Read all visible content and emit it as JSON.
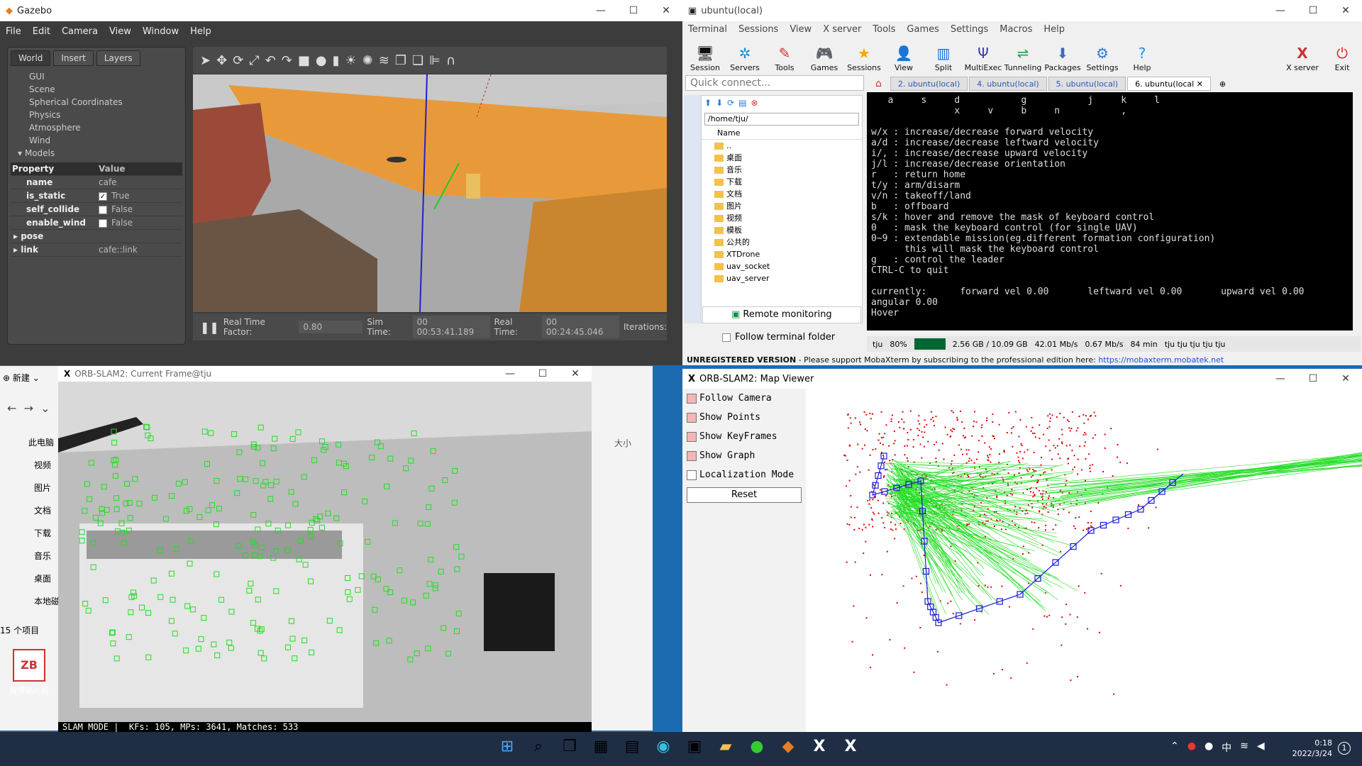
{
  "gazebo": {
    "title": "Gazebo",
    "menu": [
      "File",
      "Edit",
      "Camera",
      "View",
      "Window",
      "Help"
    ],
    "tabs": [
      "World",
      "Insert",
      "Layers"
    ],
    "tree": [
      "GUI",
      "Scene",
      "Spherical Coordinates",
      "Physics",
      "Atmosphere",
      "Wind",
      "Models"
    ],
    "prop_header": [
      "Property",
      "Value"
    ],
    "props": [
      {
        "k": "name",
        "v": "cafe"
      },
      {
        "k": "is_static",
        "v": "True"
      },
      {
        "k": "self_collide",
        "v": "False"
      },
      {
        "k": "enable_wind",
        "v": "False"
      },
      {
        "k": "pose",
        "v": ""
      },
      {
        "k": "link",
        "v": "cafe::link"
      }
    ],
    "status": {
      "rtf_label": "Real Time Factor:",
      "rtf": "0.80",
      "sim_label": "Sim Time:",
      "sim": "00 00:53:41.189",
      "real_label": "Real Time:",
      "real": "00 00:24:45.046",
      "iter_label": "Iterations:"
    }
  },
  "moba": {
    "title": "ubuntu(local)",
    "menu": [
      "Terminal",
      "Sessions",
      "View",
      "X server",
      "Tools",
      "Games",
      "Settings",
      "Macros",
      "Help"
    ],
    "tools": [
      "Session",
      "Servers",
      "Tools",
      "Games",
      "Sessions",
      "View",
      "Split",
      "MultiExec",
      "Tunneling",
      "Packages",
      "Settings",
      "Help",
      "X server",
      "Exit"
    ],
    "quick": "Quick connect...",
    "tabs": [
      "2. ubuntu(local)",
      "4. ubuntu(local)",
      "5. ubuntu(local)",
      "6. ubuntu(local"
    ],
    "path": "/home/tju/",
    "list_header": "Name",
    "files": [
      "..",
      "桌面",
      "音乐",
      "下载",
      "文档",
      "图片",
      "视频",
      "模板",
      "公共的",
      "XTDrone",
      "uav_socket",
      "uav_server"
    ],
    "remote": "Remote monitoring",
    "follow": "Follow terminal folder",
    "term_lines": [
      "   a     s     d           g           j     k     l",
      "               x     v     b     n           ,",
      "",
      "w/x : increase/decrease forward velocity",
      "a/d : increase/decrease leftward velocity",
      "i/, : increase/decrease upward velocity",
      "j/l : increase/decrease orientation",
      "r   : return home",
      "t/y : arm/disarm",
      "v/n : takeoff/land",
      "b   : offboard",
      "s/k : hover and remove the mask of keyboard control",
      "0   : mask the keyboard control (for single UAV)",
      "0~9 : extendable mission(eg.different formation configuration)",
      "      this will mask the keyboard control",
      "g   : control the leader",
      "CTRL-C to quit",
      "",
      "currently:      forward vel 0.00       leftward vel 0.00       upward vel 0.00",
      "angular 0.00",
      "Hover"
    ],
    "status": [
      "tju",
      "80%",
      "2.56 GB / 10.09 GB",
      "42.01 Mb/s",
      "0.67 Mb/s",
      "84 min",
      "tju tju tju tju tju"
    ],
    "unreg": "UNREGISTERED VERSION",
    "unreg_msg": " -  Please support MobaXterm by subscribing to the professional edition here: ",
    "unreg_link": "https://mobaxterm.mobatek.net"
  },
  "orb_current": {
    "title": "ORB-SLAM2: Current Frame@tju",
    "status": "SLAM MODE |  KFs: 105, MPs: 3641, Matches: 533"
  },
  "map_viewer": {
    "title": "ORB-SLAM2: Map Viewer",
    "options": [
      {
        "label": "Follow Camera",
        "on": true
      },
      {
        "label": "Show Points",
        "on": true
      },
      {
        "label": "Show KeyFrames",
        "on": true
      },
      {
        "label": "Show Graph",
        "on": true
      },
      {
        "label": "Localization Mode",
        "on": false
      }
    ],
    "reset": "Reset"
  },
  "explorer": {
    "new": "新建",
    "nav": [
      "此电脑",
      "视频",
      "图片",
      "文档",
      "下载",
      "音乐",
      "桌面",
      "本地磁"
    ],
    "count": "15 个项目",
    "size_col": "大小"
  },
  "desktop": {
    "icon_label": "智博贴片机"
  },
  "taskbar": {
    "time": "0:18",
    "date": "2022/3/24",
    "ime": "中"
  }
}
